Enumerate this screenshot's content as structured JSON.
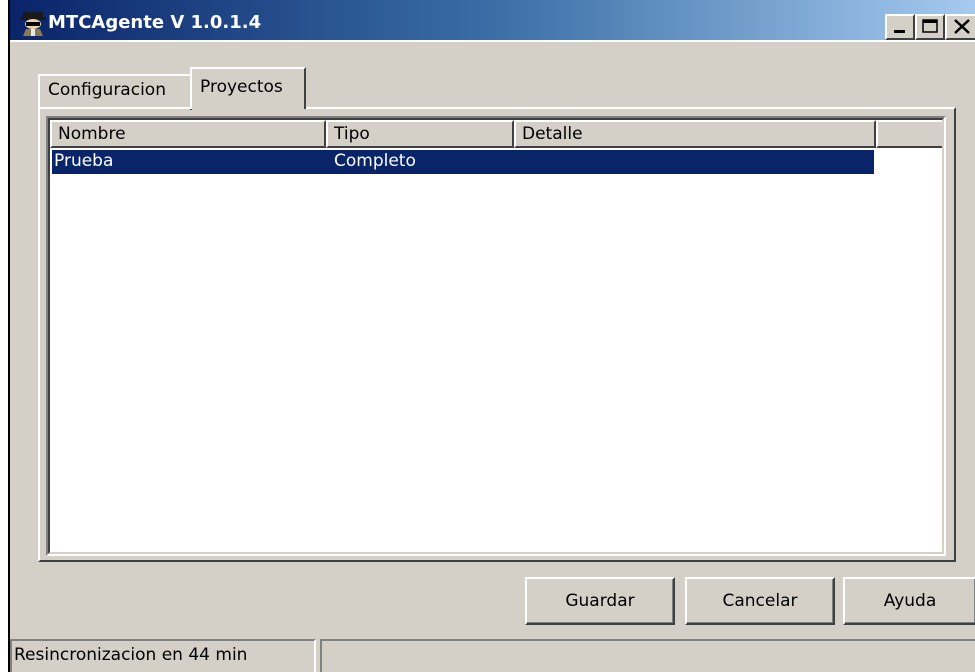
{
  "window": {
    "title": "MTCAgente V 1.0.1.4",
    "icon": "spy-agent-icon"
  },
  "caption_buttons": [
    "minimize-icon",
    "maximize-icon",
    "close-icon"
  ],
  "tabs": [
    {
      "label": "Configuracion",
      "active": false
    },
    {
      "label": "Proyectos",
      "active": true
    }
  ],
  "list": {
    "columns": [
      "Nombre",
      "Tipo",
      "Detalle",
      ""
    ],
    "rows": [
      {
        "nombre": "Prueba",
        "tipo": "Completo",
        "detalle": "",
        "selected": true
      }
    ]
  },
  "buttons": {
    "guardar": "Guardar",
    "cancelar": "Cancelar",
    "ayuda": "Ayuda"
  },
  "status": {
    "text": "Resincronizacion en 44 min",
    "secondary": ""
  },
  "colors": {
    "face": "#d4d0c8",
    "selection": "#0a246a",
    "title_gradient_start": "#0a246a",
    "title_gradient_end": "#a6caf0"
  }
}
